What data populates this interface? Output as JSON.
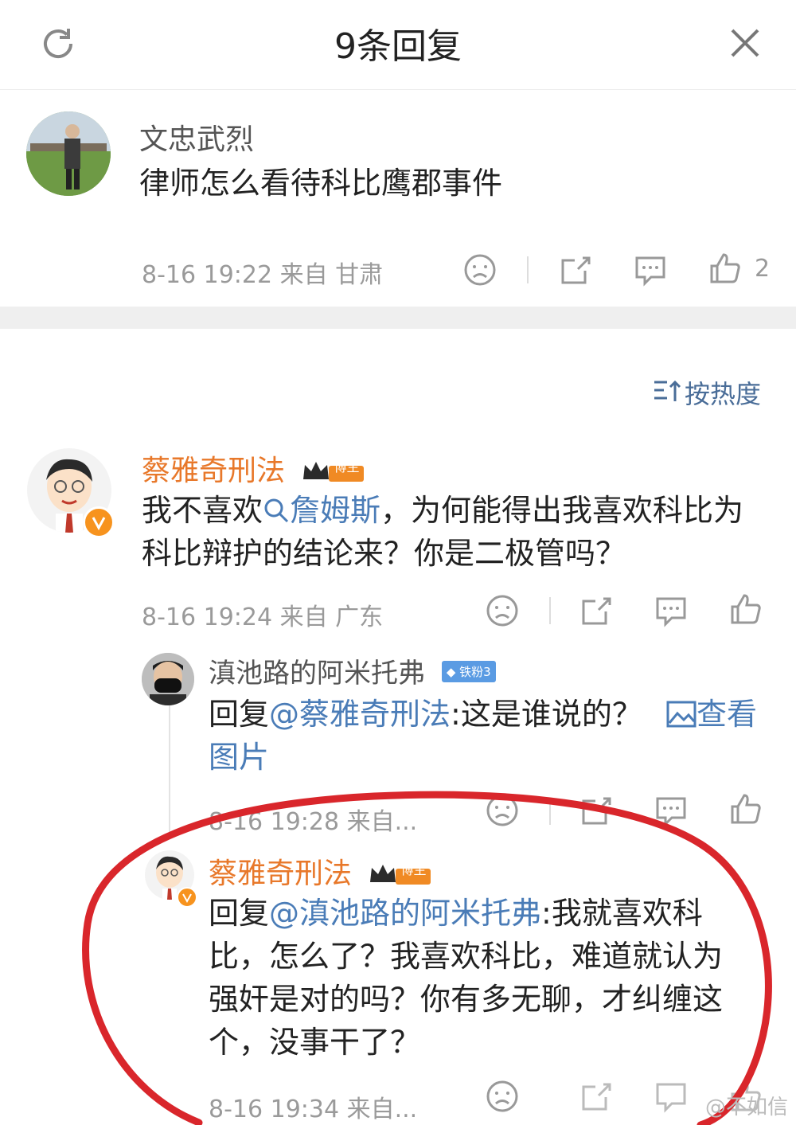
{
  "header": {
    "title": "9条回复"
  },
  "root": {
    "user": "文忠武烈",
    "text": "律师怎么看待科比鹰郡事件",
    "meta": "8-16 19:22  来自 甘肃",
    "like_count": "2"
  },
  "sort": {
    "label": "按热度"
  },
  "comments": [
    {
      "user": "蔡雅奇刑法",
      "badge": "博主",
      "text_before": "我不喜欢",
      "link": "詹姆斯",
      "text_after": "，为何能得出我喜欢科比为科比辩护的结论来？你是二极管吗？",
      "meta": "8-16 19:24  来自 广东"
    },
    {
      "user": "滇池路的阿米托弗",
      "badge": "铁粉3",
      "reply_prefix": "回复",
      "mention": "@蔡雅奇刑法",
      "text": ":这是谁说的？",
      "image_link": "查看图片",
      "meta": "8-16 19:28  来自..."
    },
    {
      "user": "蔡雅奇刑法",
      "badge": "博主",
      "reply_prefix": "回复",
      "mention": "@滇池路的阿米托弗",
      "text": ":我就喜欢科比，怎么了？我喜欢科比，难道就认为强奸是对的吗？你有多无聊，才纠缠这个，没事干了？",
      "meta": "8-16 19:34  来自..."
    }
  ],
  "watermark": "@不如信",
  "colors": {
    "orange": "#e8782a",
    "blue": "#4a7cb7",
    "circle": "#d9262b"
  }
}
